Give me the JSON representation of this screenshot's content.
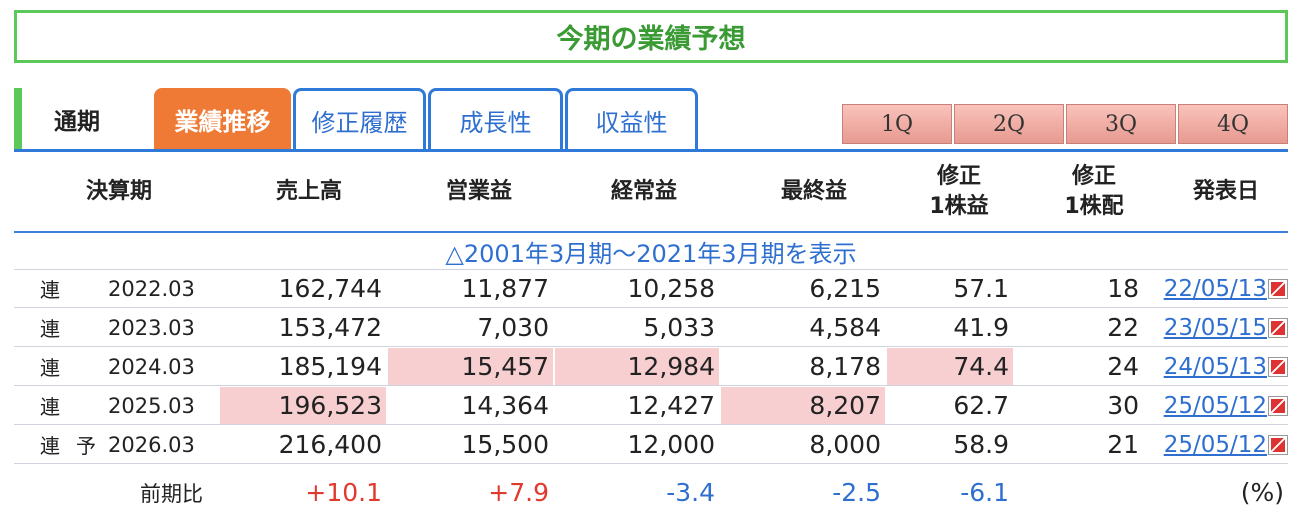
{
  "title": "今期の業績予想",
  "tabs": {
    "tsuki": "通期",
    "active": "業績推移",
    "items": [
      "修正履歴",
      "成長性",
      "収益性"
    ]
  },
  "quarters": [
    "1Q",
    "2Q",
    "3Q",
    "4Q"
  ],
  "headers": {
    "period": "決算期",
    "sales": "売上高",
    "op": "営業益",
    "ord": "経常益",
    "net": "最終益",
    "eps_l1": "修正",
    "eps_l2": "1株益",
    "div_l1": "修正",
    "div_l2": "1株配",
    "date": "発表日"
  },
  "range_link": "△2001年3月期～2021年3月期を表示",
  "rows": [
    {
      "kind": "連",
      "forecast": "",
      "period": "2022.03",
      "sales": "162,744",
      "op": "11,877",
      "ord": "10,258",
      "net": "6,215",
      "eps": "57.1",
      "div": "18",
      "date": "22/05/13"
    },
    {
      "kind": "連",
      "forecast": "",
      "period": "2023.03",
      "sales": "153,472",
      "op": "7,030",
      "ord": "5,033",
      "net": "4,584",
      "eps": "41.9",
      "div": "22",
      "date": "23/05/15"
    },
    {
      "kind": "連",
      "forecast": "",
      "period": "2024.03",
      "sales": "185,194",
      "op": "15,457",
      "ord": "12,984",
      "net": "8,178",
      "eps": "74.4",
      "div": "24",
      "date": "24/05/13"
    },
    {
      "kind": "連",
      "forecast": "",
      "period": "2025.03",
      "sales": "196,523",
      "op": "14,364",
      "ord": "12,427",
      "net": "8,207",
      "eps": "62.7",
      "div": "30",
      "date": "25/05/12"
    },
    {
      "kind": "連",
      "forecast": "予",
      "period": "2026.03",
      "sales": "216,400",
      "op": "15,500",
      "ord": "12,000",
      "net": "8,000",
      "eps": "58.9",
      "div": "21",
      "date": "25/05/12"
    }
  ],
  "comparison": {
    "label": "前期比",
    "sales": "+10.1",
    "op": "+7.9",
    "ord": "-3.4",
    "net": "-2.5",
    "eps": "-6.1",
    "unit": "(%)"
  },
  "colors": {
    "green": "#5cc85a",
    "orange": "#ee7a36",
    "blue": "#2f7ad8",
    "highlight": "#f7cfd0",
    "up": "#e03a2f",
    "down": "#2f6fd0"
  }
}
